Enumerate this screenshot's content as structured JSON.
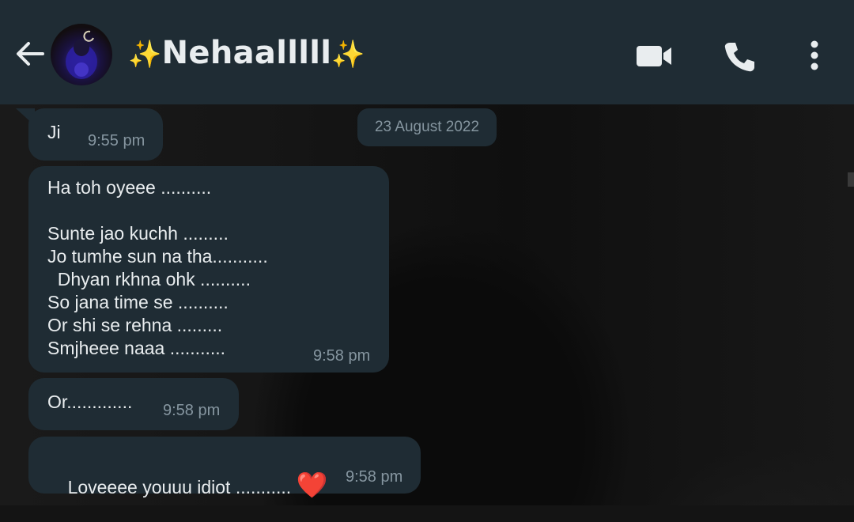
{
  "header": {
    "contact_name": "Nehaalllll",
    "sparkle_left": "✨",
    "sparkle_right": "✨",
    "icons": [
      "back-arrow-icon",
      "video-call-icon",
      "phone-icon",
      "more-options-icon"
    ]
  },
  "date_chip": "23 August 2022",
  "messages": [
    {
      "text": "Ji",
      "time": "9:55 pm"
    },
    {
      "text": "Ha toh oyeee ..........\n\nSunte jao kuchh .........\nJo tumhe sun na tha...........\n  Dhyan rkhna ohk ..........\nSo jana time se ..........\nOr shi se rehna .........\nSmjheee naaa ...........",
      "time": "9:58 pm"
    },
    {
      "text": "Or.............",
      "time": "9:58 pm"
    },
    {
      "text": "Loveeee youuu idiot ...........",
      "emoji": "❤️",
      "time": "9:58 pm"
    }
  ],
  "colors": {
    "header_bg": "#1f2c34",
    "bubble_bg": "#1f2c34",
    "text_primary": "#e9edef",
    "text_secondary": "#8696a0",
    "sparkle": "#f5c542",
    "heart": "#e0303a"
  }
}
